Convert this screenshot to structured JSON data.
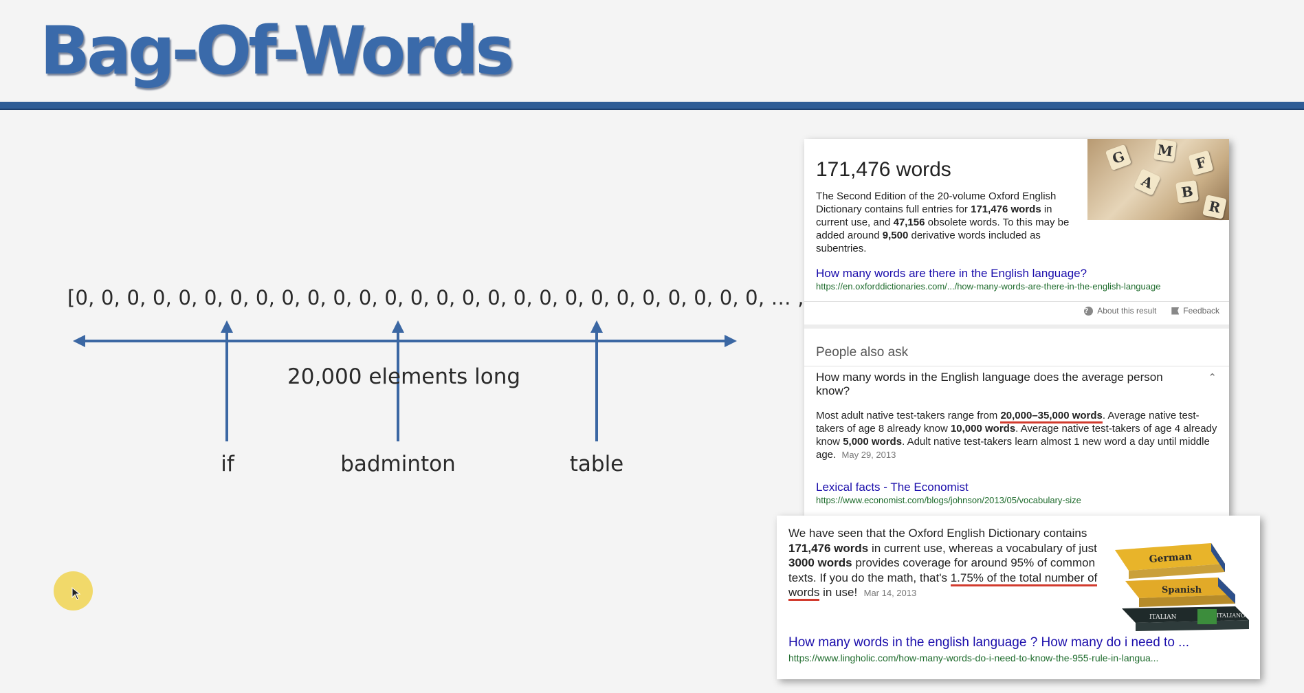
{
  "slide": {
    "title": "Bag-Of-Words",
    "vector": "[0, 0, 0, 0, 0, 0, 0, 0, 0, 0, 0, 0, 0, 0, 0, 0, 0, 0, 0, 0, 0, 0, 0, 0, 0, 0, 0, … , 0]",
    "length_label": "20,000 elements long",
    "words": [
      "if",
      "badminton",
      "table"
    ],
    "accent_color": "#3a6aaa"
  },
  "serp": {
    "kp_heading": "171,476 words",
    "kp_desc": {
      "t1": "The Second Edition of the 20-volume Oxford English Dictionary contains full entries for ",
      "b1": "171,476 words",
      "t2": " in current use, and ",
      "b2": "47,156",
      "t3": " obsolete words. To this may be added around ",
      "b3": "9,500",
      "t4": " derivative words included as subentries."
    },
    "kp_image_letters": [
      "M",
      "F",
      "G",
      "A",
      "B",
      "R"
    ],
    "result1": {
      "title": "How many words are there in the English language?",
      "url": "https://en.oxforddictionaries.com/.../how-many-words-are-there-in-the-english-language"
    },
    "about_label": "About this result",
    "feedback_label": "Feedback",
    "paa_title": "People also ask",
    "paa_question": "How many words in the English language does the average person know?",
    "paa_answer": {
      "t1": "Most adult native test-takers range from ",
      "b1": "20,000–35,000 words",
      "t2": ". Average native test-takers of age 8 already know ",
      "b2": "10,000 words",
      "t3": ". Average native test-takers of age 4 already know ",
      "b3": "5,000 words",
      "t4": ". Adult native test-takers learn almost 1 new word a day until middle age.",
      "date": "May 29, 2013"
    },
    "result2": {
      "title": "Lexical facts - The Economist",
      "url": "https://www.economist.com/blogs/johnson/2013/05/vocabulary-size"
    }
  },
  "card": {
    "t1": "We have seen that the Oxford English Dictionary contains ",
    "b1": "171,476 words",
    "t2": " in current use, whereas a vocabulary of just ",
    "b2": "3000 words",
    "t3": " provides coverage for around 95% of common texts. If you do the math, that's ",
    "u1": "1.75% of the total number of words",
    "t4": " in use!",
    "date": "Mar 14, 2013",
    "link_title": "How many words in the english language ? How many do i need to ...",
    "link_url": "https://www.lingholic.com/how-many-words-do-i-need-to-know-the-955-rule-in-langua...",
    "book_labels": [
      "German",
      "Spanish",
      "ITALIAN",
      "ITALIANO"
    ]
  }
}
